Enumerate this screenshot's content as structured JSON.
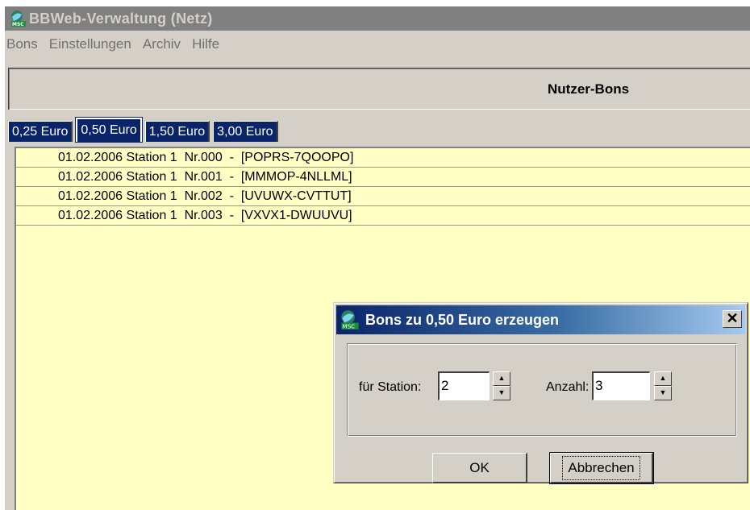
{
  "window": {
    "title": "BBWeb-Verwaltung (Netz)",
    "icon": "msc-logo-icon"
  },
  "menu": {
    "items": [
      "Bons",
      "Einstellungen",
      "Archiv",
      "Hilfe"
    ]
  },
  "header": {
    "title": "Nutzer-Bons"
  },
  "tabs": {
    "items": [
      "0,25 Euro",
      "0,50 Euro",
      "1,50 Euro",
      "3,00 Euro"
    ],
    "active": "0,50 Euro"
  },
  "list": {
    "rows": [
      "01.02.2006 Station 1  Nr.000  -  [POPRS-7QOOPO]",
      "01.02.2006 Station 1  Nr.001  -  [MMMOP-4NLLML]",
      "01.02.2006 Station 1  Nr.002  -  [UVUWX-CVTTUT]",
      "01.02.2006 Station 1  Nr.003  -  [VXVX1-DWUUVU]"
    ]
  },
  "dialog": {
    "title": "Bons zu 0,50 Euro erzeugen",
    "close_glyph": "✕",
    "station_label": "für Station:",
    "station_value": "2",
    "count_label": "Anzahl:",
    "count_value": "3",
    "ok_label": "OK",
    "cancel_label": "Abbrechen"
  },
  "colors": {
    "title_inactive": "#808080",
    "tab_bg": "#0a246a",
    "list_bg": "#ffffc4",
    "dialog_title_start": "#0a246a",
    "dialog_title_end": "#a6caf0"
  }
}
